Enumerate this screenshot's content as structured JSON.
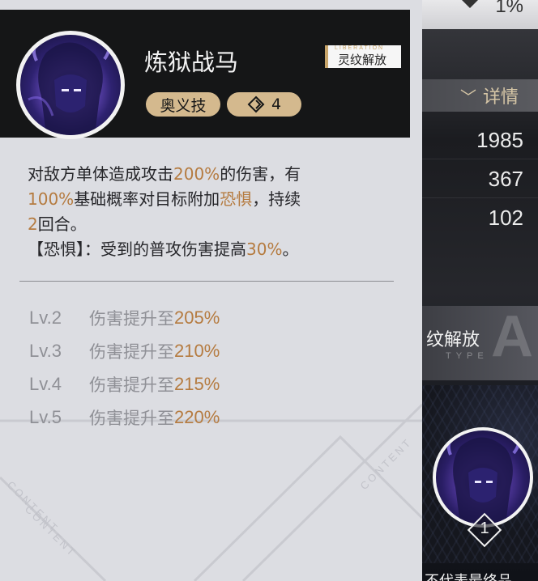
{
  "background": {
    "top_value": "1%",
    "detail_button": "详情",
    "stats": [
      "1985",
      "367",
      "102"
    ],
    "unlock_title": "纹解放",
    "unlock_type_text": "TYPE",
    "unlock_letter": "A",
    "bottom_notice": "当前为测试版本，不代表最终品",
    "cost_badge_number": "1"
  },
  "tooltip": {
    "skill_name": "炼狱战马",
    "unlock_badge_small": "LIBERATION",
    "unlock_badge": "灵纹解放",
    "skill_type": "奥义技",
    "cost": "4",
    "description": {
      "line1_a": "对敌方单体造成攻击",
      "line1_hl": "200%",
      "line1_b": "的伤害，有",
      "line2_hl": "100%",
      "line2_a": "基础概率对目标附加",
      "line2_hl2": "恐惧",
      "line2_b": "，持续",
      "line3_hl": "2",
      "line3_a": "回合。",
      "line4_a": "【恐惧】：受到的普攻伤害提高",
      "line4_hl": "30%",
      "line4_b": "。"
    },
    "levels": [
      {
        "level": "Lv.2",
        "text": "伤害提升至",
        "value": "205%"
      },
      {
        "level": "Lv.3",
        "text": "伤害提升至",
        "value": "210%"
      },
      {
        "level": "Lv.4",
        "text": "伤害提升至",
        "value": "215%"
      },
      {
        "level": "Lv.5",
        "text": "伤害提升至",
        "value": "220%"
      }
    ],
    "watermark": "CONTENT"
  },
  "colors": {
    "accent": "#b57b40",
    "tag": "#d4b98e",
    "header": "#151617",
    "panel": "#dcdde2"
  }
}
